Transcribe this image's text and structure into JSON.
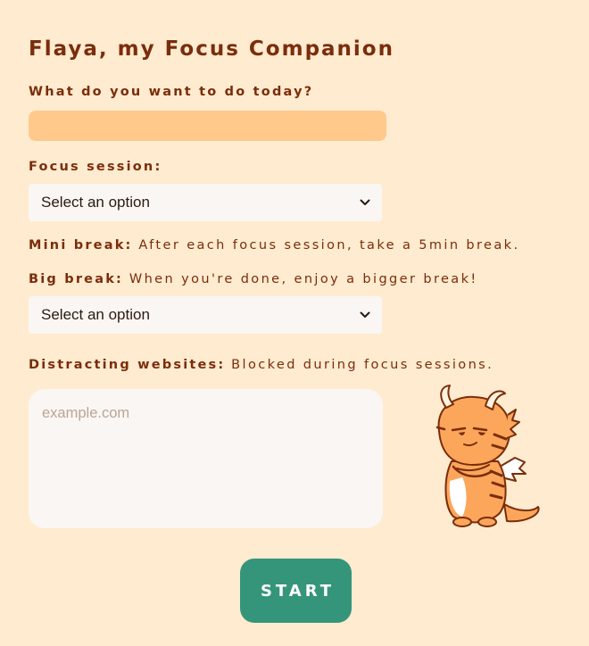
{
  "app": {
    "title": "Flaya, my Focus Companion"
  },
  "task": {
    "label": "What do you want to do today?",
    "value": ""
  },
  "focus_session": {
    "label": "Focus session:",
    "selected": "Select an option"
  },
  "mini_break": {
    "label": "Mini break:",
    "description": "After each focus session, take a 5min break."
  },
  "big_break": {
    "label": "Big break:",
    "description": "When you're done, enjoy a bigger break!",
    "selected": "Select an option"
  },
  "distracting_websites": {
    "label": "Distracting websites:",
    "description": "Blocked during focus sessions.",
    "placeholder": "example.com",
    "value": ""
  },
  "actions": {
    "start_label": "START"
  },
  "icons": {
    "select_chevron": "chevron-down-icon",
    "mascot": "dragon-mascot"
  },
  "colors": {
    "background": "#FFEBCF",
    "text": "#7A2D0C",
    "task_input": "#FFC98B",
    "field": "#FAF6F3",
    "start_button": "#35957A",
    "mascot_orange": "#FBA65A"
  }
}
